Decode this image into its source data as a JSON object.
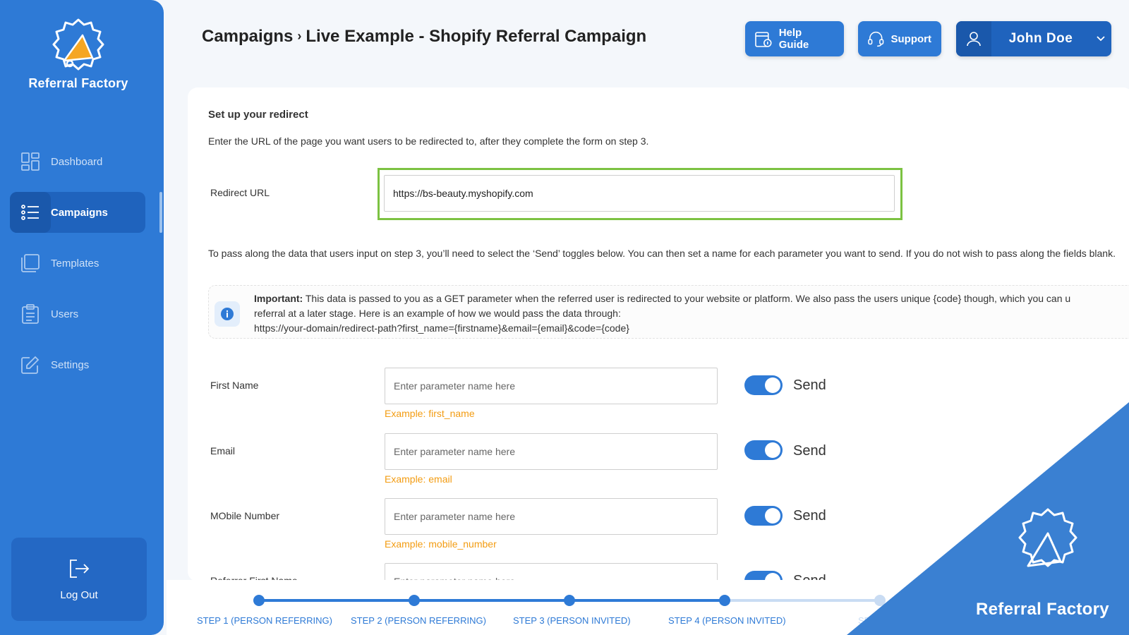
{
  "sidebar": {
    "brand": "Referral Factory",
    "items": [
      {
        "label": "Dashboard",
        "icon": "dashboard-icon"
      },
      {
        "label": "Campaigns",
        "icon": "list-icon"
      },
      {
        "label": "Templates",
        "icon": "templates-icon"
      },
      {
        "label": "Users",
        "icon": "clipboard-icon"
      },
      {
        "label": "Settings",
        "icon": "edit-icon"
      }
    ],
    "active": "Campaigns",
    "logout": "Log Out"
  },
  "header": {
    "breadcrumb_root": "Campaigns",
    "breadcrumb_sep": "›",
    "breadcrumb_current": "Live Example - Shopify Referral Campaign",
    "help_label": "Help Guide",
    "support_label": "Support",
    "user_name": "John Doe"
  },
  "redirect": {
    "title": "Set up your redirect",
    "description": "Enter the URL of the page you want users to be redirected to, after they complete the form on step 3.",
    "url_label": "Redirect URL",
    "url_value": "https://bs-beauty.myshopify.com",
    "pass_text": "To pass along the data that users input on step 3, you’ll need to select the ‘Send’ toggles below. You can then set a name for each parameter you want to send. If you do not wish to pass along the fields blank.",
    "notice_bold": "Important:",
    "notice_line1": " This data is passed to you as a GET parameter when the referred user is redirected to your website or platform. We also pass the users unique {code} though, which you can u",
    "notice_line2": "referral at a later stage. Here is an example of how we would pass the data through:",
    "notice_line3": "https://your-domain/redirect-path?first_name={firstname}&email={email}&code={code}"
  },
  "params": [
    {
      "label": "First Name",
      "placeholder": "Enter parameter name here",
      "example": "Example: first_name",
      "toggle": "Send"
    },
    {
      "label": "Email",
      "placeholder": "Enter parameter name here",
      "example": "Example: email",
      "toggle": "Send"
    },
    {
      "label": "MObile Number",
      "placeholder": "Enter parameter name here",
      "example": "Example: mobile_number",
      "toggle": "Send"
    },
    {
      "label": "Referrer First Name",
      "placeholder": "Enter parameter name here",
      "toggle": "Send"
    }
  ],
  "steps": [
    {
      "label": "STEP 1 (PERSON REFERRING)"
    },
    {
      "label": "STEP 2 (PERSON REFERRING)"
    },
    {
      "label": "STEP 3 (PERSON INVITED)"
    },
    {
      "label": "STEP 4 (PERSON INVITED)"
    },
    {
      "label": "SETTIN"
    }
  ],
  "watermark": {
    "brand": "Referral Factory"
  },
  "colors": {
    "primary": "#2e7ad6",
    "highlight": "#7cc242",
    "example": "#f39c12"
  }
}
